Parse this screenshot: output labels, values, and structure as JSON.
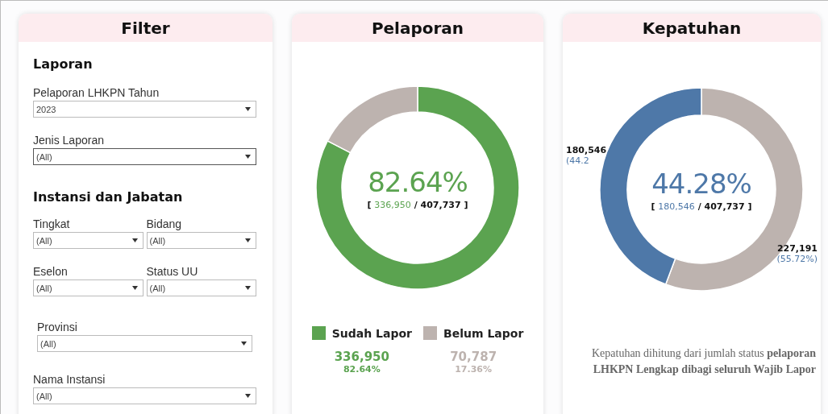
{
  "filter": {
    "title": "Filter",
    "sections": [
      {
        "heading": "Laporan",
        "rows": [
          [
            {
              "label": "Pelaporan LHKPN Tahun",
              "value": "2023",
              "focused": false
            }
          ],
          [
            {
              "label": "Jenis Laporan",
              "value": "(All)",
              "focused": true
            }
          ]
        ]
      },
      {
        "heading": "Instansi dan Jabatan",
        "rows": [
          [
            {
              "label": "Tingkat",
              "value": "(All)",
              "focused": false
            },
            {
              "label": "Bidang",
              "value": "(All)",
              "focused": false
            }
          ],
          [
            {
              "label": "Eselon",
              "value": "(All)",
              "focused": false
            },
            {
              "label": "Status UU",
              "value": "(All)",
              "focused": false
            }
          ],
          [
            {
              "label": "Provinsi",
              "value": "(All)",
              "focused": false
            }
          ],
          [
            {
              "label": "Nama Instansi",
              "value": "(All)",
              "focused": false
            }
          ]
        ]
      }
    ]
  },
  "pelaporan": {
    "title": "Pelaporan",
    "center_value": "82.64%",
    "center_detail": {
      "open": "[",
      "part": "336,950",
      "separator": "/",
      "total": "407,737",
      "close": "]"
    },
    "chart_data": {
      "type": "donut",
      "series": [
        {
          "values": [
            82.64,
            17.36
          ]
        }
      ]
    },
    "legend": [
      {
        "label": "Sudah Lapor",
        "color": "#5ba350",
        "count": "336,950",
        "percent": "82.64%"
      },
      {
        "label": "Belum Lapor",
        "color": "#bdb3af",
        "count": "70,787",
        "percent": "17.36%"
      }
    ]
  },
  "kepatuhan": {
    "title": "Kepatuhan",
    "center_value": "44.28%",
    "center_detail": {
      "open": "[",
      "part": "180,546",
      "separator": "/",
      "total": "407,737",
      "close": "]"
    },
    "chart_data": {
      "type": "donut",
      "series": [
        {
          "values": [
            55.72,
            44.28
          ]
        }
      ]
    },
    "slices": [
      {
        "color": "#bdb3af",
        "count": "227,191",
        "percent": "(55.72%)"
      },
      {
        "color": "#4e78a8",
        "count": "180,546",
        "percent": "(44.2"
      }
    ],
    "note": "Kepatuhan dihitung dari jumlah status **pelaporan LHKPN Lengkap dibagi seluruh Wajib Lapor**"
  }
}
